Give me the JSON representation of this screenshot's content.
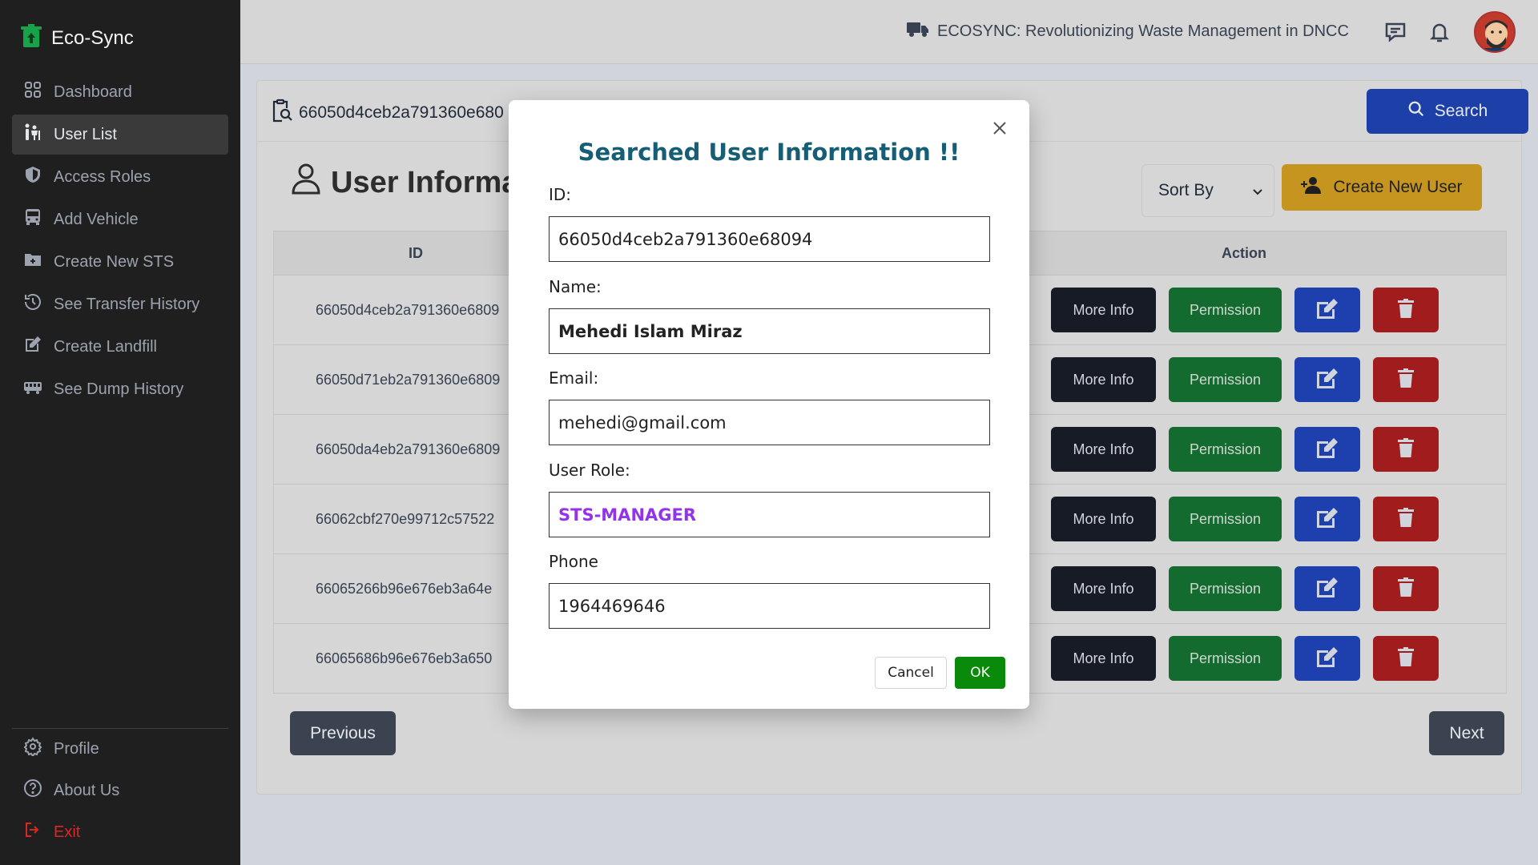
{
  "app": {
    "name": "Eco-Sync"
  },
  "sidebar": {
    "items": [
      {
        "label": "Dashboard",
        "icon": "grid-icon",
        "active": false
      },
      {
        "label": "User List",
        "icon": "users-icon",
        "active": true
      },
      {
        "label": "Access Roles",
        "icon": "shield-icon",
        "active": false
      },
      {
        "label": "Add Vehicle",
        "icon": "bus-icon",
        "active": false
      },
      {
        "label": "Create New STS",
        "icon": "folder-plus-icon",
        "active": false
      },
      {
        "label": "See Transfer History",
        "icon": "history-icon",
        "active": false
      },
      {
        "label": "Create Landfill",
        "icon": "edit-square-icon",
        "active": false
      },
      {
        "label": "See Dump History",
        "icon": "truck-wide-icon",
        "active": false
      }
    ],
    "bottom": [
      {
        "label": "Profile",
        "icon": "gear-icon"
      },
      {
        "label": "About Us",
        "icon": "question-icon"
      },
      {
        "label": "Exit",
        "icon": "logout-icon"
      }
    ]
  },
  "header": {
    "headline": "ECOSYNC: Revolutionizing Waste Management in DNCC"
  },
  "search": {
    "value": "66050d4ceb2a791360e680",
    "button_label": "Search"
  },
  "section": {
    "title": "User Informa"
  },
  "sort": {
    "label": "Sort By"
  },
  "create_button": {
    "label": "Create New User"
  },
  "table": {
    "headers": {
      "id": "ID",
      "action": "Action"
    },
    "rows": [
      {
        "id": "66050d4ceb2a791360e6809"
      },
      {
        "id": "66050d71eb2a791360e6809"
      },
      {
        "id": "66050da4eb2a791360e6809"
      },
      {
        "id": "66062cbf270e99712c57522"
      },
      {
        "id": "66065266b96e676eb3a64e"
      },
      {
        "id": "66065686b96e676eb3a650"
      }
    ],
    "actions": {
      "more": "More Info",
      "permission": "Permission"
    }
  },
  "pager": {
    "prev": "Previous",
    "next": "Next"
  },
  "modal": {
    "title": "Searched User Information !!",
    "id_label": "ID:",
    "id_value": "66050d4ceb2a791360e68094",
    "name_label": "Name:",
    "name_value": "Mehedi Islam Miraz",
    "email_label": "Email:",
    "email_value": "mehedi@gmail.com",
    "role_label": "User Role:",
    "role_value": "STS-MANAGER",
    "phone_label": "Phone",
    "phone_value": "1964469646",
    "cancel_label": "Cancel",
    "ok_label": "OK"
  },
  "colors": {
    "sidebar_bg": "#1f1f1f",
    "search_btn": "#1d3fa8",
    "create_btn": "#c69520",
    "modal_title": "#155e75",
    "role_text": "#9333ea",
    "ok_btn": "#0a8a0a"
  }
}
